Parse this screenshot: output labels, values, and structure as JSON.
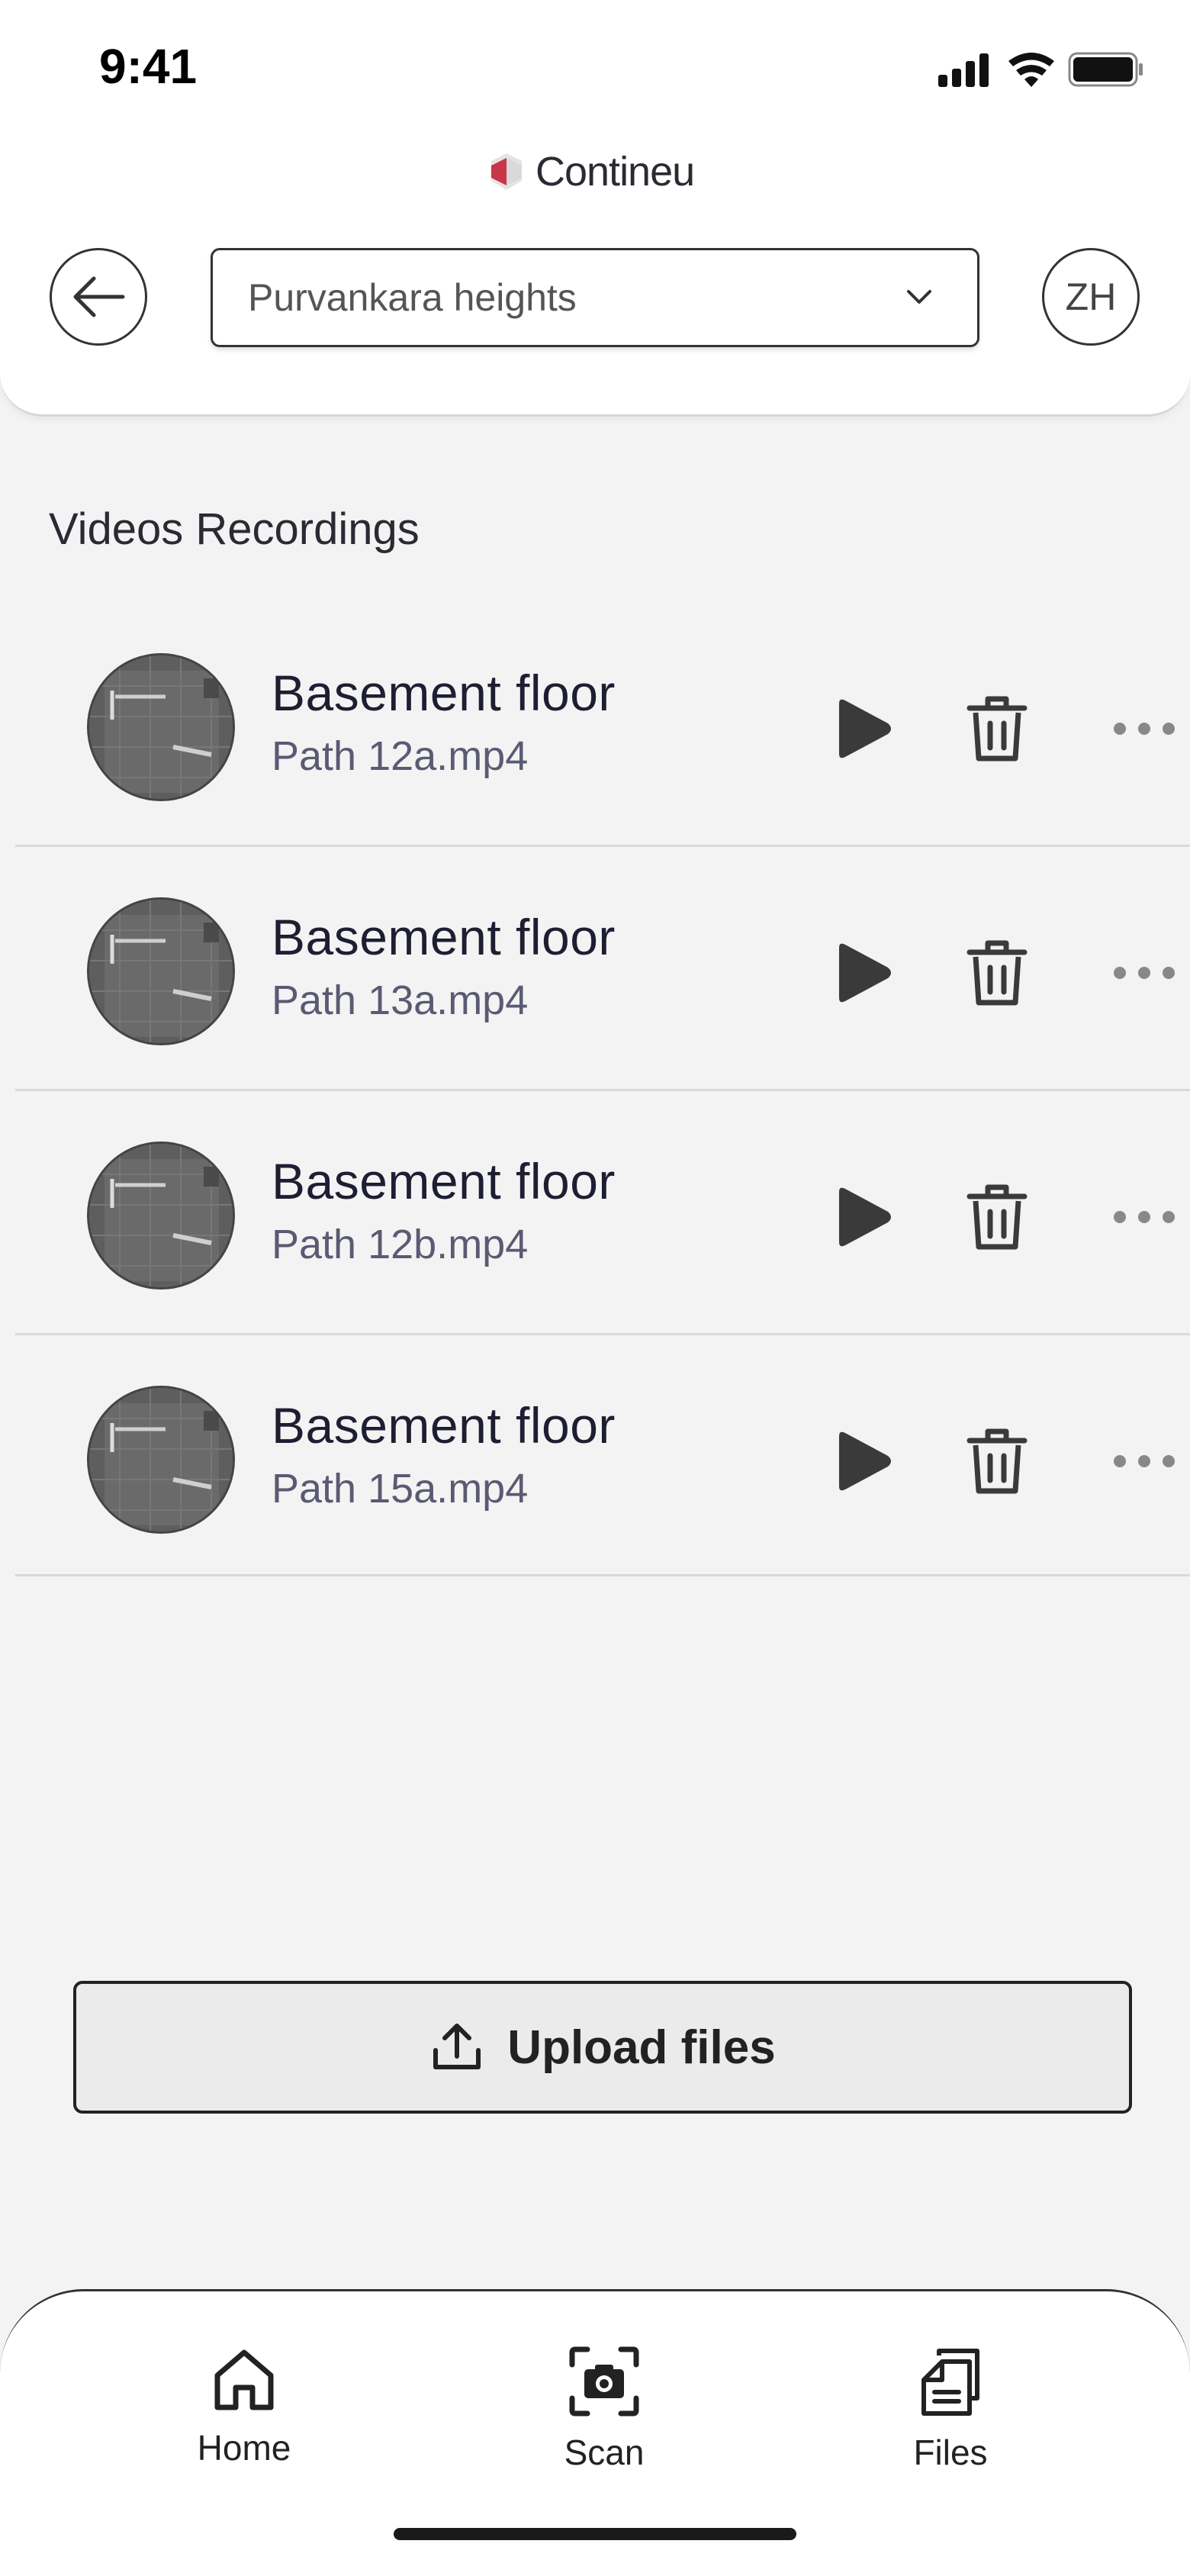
{
  "status_bar": {
    "time": "9:41"
  },
  "brand": {
    "name": "Contineu",
    "accent": "#c8364a"
  },
  "header": {
    "back_icon": "arrow-left-icon",
    "project_select": {
      "value": "Purvankara heights"
    },
    "avatar_initials": "ZH"
  },
  "section": {
    "title": "Videos Recordings"
  },
  "recordings": [
    {
      "title": "Basement floor",
      "file": "Path 12a.mp4"
    },
    {
      "title": "Basement floor",
      "file": "Path 13a.mp4"
    },
    {
      "title": "Basement floor",
      "file": "Path 12b.mp4"
    },
    {
      "title": "Basement floor",
      "file": "Path 15a.mp4"
    }
  ],
  "upload": {
    "label": "Upload files"
  },
  "nav": {
    "items": [
      {
        "label": "Home",
        "icon": "home-icon"
      },
      {
        "label": "Scan",
        "icon": "camera-scan-icon"
      },
      {
        "label": "Files",
        "icon": "files-icon"
      }
    ]
  }
}
